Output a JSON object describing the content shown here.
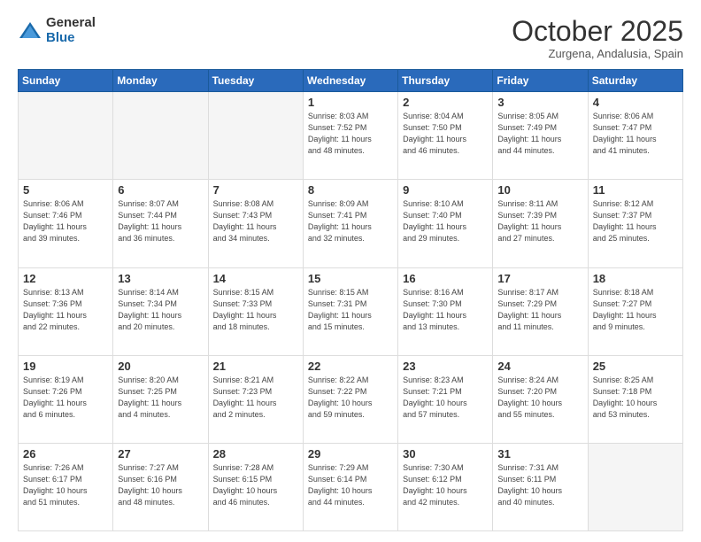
{
  "logo": {
    "general": "General",
    "blue": "Blue"
  },
  "header": {
    "month": "October 2025",
    "location": "Zurgena, Andalusia, Spain"
  },
  "weekdays": [
    "Sunday",
    "Monday",
    "Tuesday",
    "Wednesday",
    "Thursday",
    "Friday",
    "Saturday"
  ],
  "weeks": [
    [
      {
        "day": "",
        "info": ""
      },
      {
        "day": "",
        "info": ""
      },
      {
        "day": "",
        "info": ""
      },
      {
        "day": "1",
        "info": "Sunrise: 8:03 AM\nSunset: 7:52 PM\nDaylight: 11 hours\nand 48 minutes."
      },
      {
        "day": "2",
        "info": "Sunrise: 8:04 AM\nSunset: 7:50 PM\nDaylight: 11 hours\nand 46 minutes."
      },
      {
        "day": "3",
        "info": "Sunrise: 8:05 AM\nSunset: 7:49 PM\nDaylight: 11 hours\nand 44 minutes."
      },
      {
        "day": "4",
        "info": "Sunrise: 8:06 AM\nSunset: 7:47 PM\nDaylight: 11 hours\nand 41 minutes."
      }
    ],
    [
      {
        "day": "5",
        "info": "Sunrise: 8:06 AM\nSunset: 7:46 PM\nDaylight: 11 hours\nand 39 minutes."
      },
      {
        "day": "6",
        "info": "Sunrise: 8:07 AM\nSunset: 7:44 PM\nDaylight: 11 hours\nand 36 minutes."
      },
      {
        "day": "7",
        "info": "Sunrise: 8:08 AM\nSunset: 7:43 PM\nDaylight: 11 hours\nand 34 minutes."
      },
      {
        "day": "8",
        "info": "Sunrise: 8:09 AM\nSunset: 7:41 PM\nDaylight: 11 hours\nand 32 minutes."
      },
      {
        "day": "9",
        "info": "Sunrise: 8:10 AM\nSunset: 7:40 PM\nDaylight: 11 hours\nand 29 minutes."
      },
      {
        "day": "10",
        "info": "Sunrise: 8:11 AM\nSunset: 7:39 PM\nDaylight: 11 hours\nand 27 minutes."
      },
      {
        "day": "11",
        "info": "Sunrise: 8:12 AM\nSunset: 7:37 PM\nDaylight: 11 hours\nand 25 minutes."
      }
    ],
    [
      {
        "day": "12",
        "info": "Sunrise: 8:13 AM\nSunset: 7:36 PM\nDaylight: 11 hours\nand 22 minutes."
      },
      {
        "day": "13",
        "info": "Sunrise: 8:14 AM\nSunset: 7:34 PM\nDaylight: 11 hours\nand 20 minutes."
      },
      {
        "day": "14",
        "info": "Sunrise: 8:15 AM\nSunset: 7:33 PM\nDaylight: 11 hours\nand 18 minutes."
      },
      {
        "day": "15",
        "info": "Sunrise: 8:15 AM\nSunset: 7:31 PM\nDaylight: 11 hours\nand 15 minutes."
      },
      {
        "day": "16",
        "info": "Sunrise: 8:16 AM\nSunset: 7:30 PM\nDaylight: 11 hours\nand 13 minutes."
      },
      {
        "day": "17",
        "info": "Sunrise: 8:17 AM\nSunset: 7:29 PM\nDaylight: 11 hours\nand 11 minutes."
      },
      {
        "day": "18",
        "info": "Sunrise: 8:18 AM\nSunset: 7:27 PM\nDaylight: 11 hours\nand 9 minutes."
      }
    ],
    [
      {
        "day": "19",
        "info": "Sunrise: 8:19 AM\nSunset: 7:26 PM\nDaylight: 11 hours\nand 6 minutes."
      },
      {
        "day": "20",
        "info": "Sunrise: 8:20 AM\nSunset: 7:25 PM\nDaylight: 11 hours\nand 4 minutes."
      },
      {
        "day": "21",
        "info": "Sunrise: 8:21 AM\nSunset: 7:23 PM\nDaylight: 11 hours\nand 2 minutes."
      },
      {
        "day": "22",
        "info": "Sunrise: 8:22 AM\nSunset: 7:22 PM\nDaylight: 10 hours\nand 59 minutes."
      },
      {
        "day": "23",
        "info": "Sunrise: 8:23 AM\nSunset: 7:21 PM\nDaylight: 10 hours\nand 57 minutes."
      },
      {
        "day": "24",
        "info": "Sunrise: 8:24 AM\nSunset: 7:20 PM\nDaylight: 10 hours\nand 55 minutes."
      },
      {
        "day": "25",
        "info": "Sunrise: 8:25 AM\nSunset: 7:18 PM\nDaylight: 10 hours\nand 53 minutes."
      }
    ],
    [
      {
        "day": "26",
        "info": "Sunrise: 7:26 AM\nSunset: 6:17 PM\nDaylight: 10 hours\nand 51 minutes."
      },
      {
        "day": "27",
        "info": "Sunrise: 7:27 AM\nSunset: 6:16 PM\nDaylight: 10 hours\nand 48 minutes."
      },
      {
        "day": "28",
        "info": "Sunrise: 7:28 AM\nSunset: 6:15 PM\nDaylight: 10 hours\nand 46 minutes."
      },
      {
        "day": "29",
        "info": "Sunrise: 7:29 AM\nSunset: 6:14 PM\nDaylight: 10 hours\nand 44 minutes."
      },
      {
        "day": "30",
        "info": "Sunrise: 7:30 AM\nSunset: 6:12 PM\nDaylight: 10 hours\nand 42 minutes."
      },
      {
        "day": "31",
        "info": "Sunrise: 7:31 AM\nSunset: 6:11 PM\nDaylight: 10 hours\nand 40 minutes."
      },
      {
        "day": "",
        "info": ""
      }
    ]
  ]
}
